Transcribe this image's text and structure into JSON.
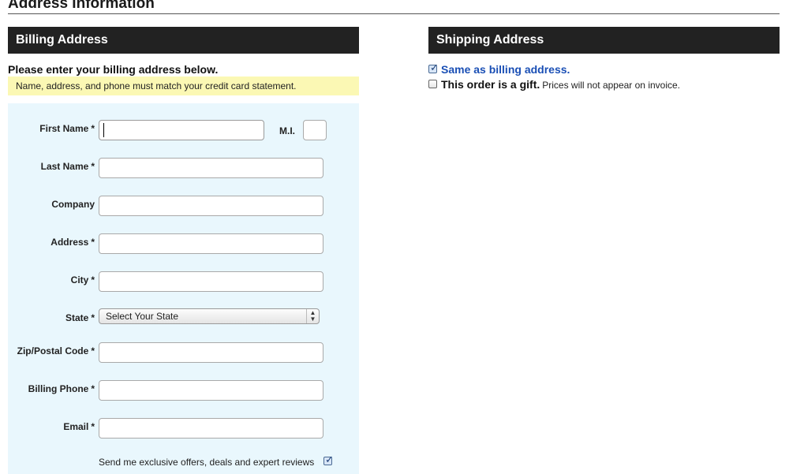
{
  "page": {
    "section_title": "Address Information"
  },
  "billing": {
    "header": "Billing Address",
    "intro": "Please enter your billing address below.",
    "notice": "Name, address, and phone must match your credit card statement.",
    "required_marker": "*",
    "fields": {
      "first_name": {
        "label": "First Name",
        "value": ""
      },
      "mi": {
        "label": "M.I.",
        "value": ""
      },
      "last_name": {
        "label": "Last Name",
        "value": ""
      },
      "company": {
        "label": "Company",
        "value": ""
      },
      "address": {
        "label": "Address",
        "value": ""
      },
      "city": {
        "label": "City",
        "value": ""
      },
      "state": {
        "label": "State",
        "selected": "Select Your State"
      },
      "zip": {
        "label": "Zip/Postal Code",
        "value": ""
      },
      "phone": {
        "label": "Billing Phone",
        "value": ""
      },
      "email": {
        "label": "Email",
        "value": ""
      }
    },
    "offers_label": "Send me exclusive offers, deals and expert reviews",
    "offers_checked": true
  },
  "shipping": {
    "header": "Shipping Address",
    "same_as_billing_label": "Same as billing address.",
    "same_as_billing_checked": true,
    "gift_label": "This order is a gift.",
    "gift_note": "Prices will not appear on invoice.",
    "gift_checked": false
  },
  "icons": {
    "checkmark": "checkmark-icon",
    "select_arrows": "select-arrows-icon"
  },
  "colors": {
    "header_bg": "#222222",
    "notice_bg": "#fbf8b4",
    "form_bg": "#e9f7fd",
    "link_blue": "#1a4fb5"
  }
}
